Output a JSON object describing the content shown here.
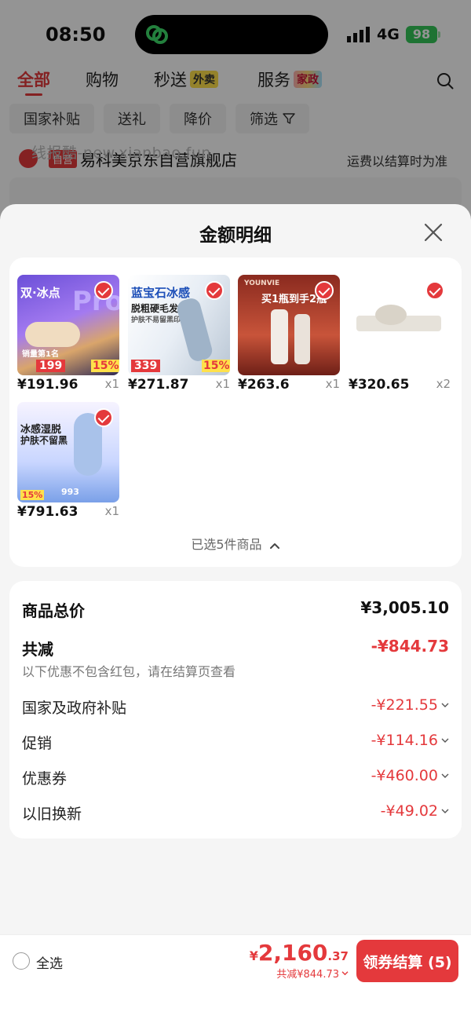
{
  "status_bar": {
    "time": "08:50",
    "network": "4G",
    "battery": "98"
  },
  "categories": [
    {
      "label": "全部",
      "badge": ""
    },
    {
      "label": "购物",
      "badge": ""
    },
    {
      "label": "秒送",
      "badge": "外卖"
    },
    {
      "label": "服务",
      "badge": "家政"
    }
  ],
  "filters": [
    "国家补贴",
    "送礼",
    "降价",
    "筛选"
  ],
  "store": {
    "tag": "自营",
    "name": "易科美京东自营旗舰店",
    "freight_note": "运费以结算时为准"
  },
  "watermark": "线报酷-new.xianbao.fun",
  "sheet": {
    "title": "金额明细",
    "items": [
      {
        "price": "¥191.96",
        "qty": "x1",
        "thumb": {
          "t1": "双·冰点",
          "t2": "Pro",
          "t3": "销量第1名",
          "t4": "199",
          "t5": "15%"
        }
      },
      {
        "price": "¥271.87",
        "qty": "x1",
        "thumb": {
          "t1": "蓝宝石冰感",
          "t2": "脱粗硬毛发",
          "t3": "护肤不易留黑印",
          "t4": "339",
          "t5": "15%"
        }
      },
      {
        "price": "¥263.6",
        "qty": "x1",
        "thumb": {
          "t1": "买1瓶到手2瓶",
          "t2": "YOUNVIE"
        }
      },
      {
        "price": "¥320.65",
        "qty": "x2",
        "thumb": {}
      },
      {
        "price": "¥791.63",
        "qty": "x1",
        "thumb": {
          "t1": "冰感湿脱",
          "t2": "护肤不留黑",
          "t3": "993",
          "t4": "15%"
        }
      }
    ],
    "selected_info": "已选5件商品"
  },
  "summary": {
    "total_label": "商品总价",
    "total_value": "¥3,005.10",
    "reduce_label": "共减",
    "reduce_value": "-¥844.73",
    "note": "以下优惠不包含红包，请在结算页查看",
    "rows": [
      {
        "label": "国家及政府补贴",
        "value": "-¥221.55"
      },
      {
        "label": "促销",
        "value": "-¥114.16"
      },
      {
        "label": "优惠券",
        "value": "-¥460.00"
      },
      {
        "label": "以旧换新",
        "value": "-¥49.02"
      }
    ]
  },
  "bottom": {
    "select_all": "全选",
    "currency": "¥",
    "total_int": "2,160",
    "total_dec": ".37",
    "reduce_text": "共减¥844.73",
    "checkout_label": "领券结算 (5)"
  },
  "colors": {
    "accent": "#e4393c",
    "battery": "#34c759"
  }
}
